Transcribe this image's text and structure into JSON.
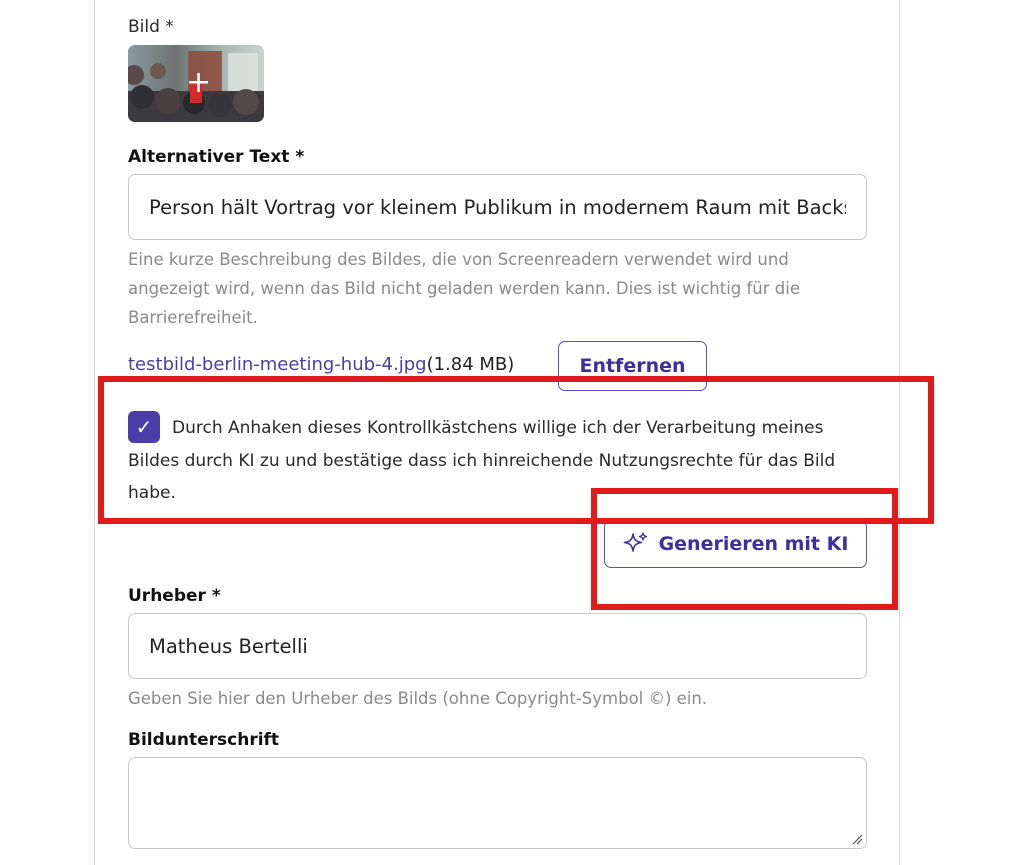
{
  "image_field": {
    "label": "Bild *",
    "add_icon": "plus-icon"
  },
  "alt_text": {
    "label": "Alternativer Text *",
    "value": "Person hält Vortrag vor kleinem Publikum in modernem Raum mit Backst",
    "help": "Eine kurze Beschreibung des Bildes, die von Screenreadern verwendet wird und angezeigt wird, wenn das Bild nicht geladen werden kann. Dies ist wichtig für die Barrierefreiheit."
  },
  "file": {
    "name": "testbild-berlin-meeting-hub-4.jpg",
    "size": "(1.84 MB)",
    "remove_label": "Entfernen"
  },
  "consent": {
    "checked": true,
    "text": "Durch Anhaken dieses Kontrollkästchens willige ich der Verarbeitung meines Bildes durch KI zu und bestätige dass ich hinreichende Nutzungsrechte für das Bild habe."
  },
  "generate": {
    "label": "Generieren mit KI",
    "icon": "sparkle-icon"
  },
  "author": {
    "label": "Urheber *",
    "value": "Matheus Bertelli",
    "help": "Geben Sie hier den Urheber des Bilds (ohne Copyright-Symbol ©) ein."
  },
  "caption": {
    "label": "Bildunterschrift",
    "value": ""
  },
  "colors": {
    "accent": "#4a3da8",
    "highlight": "#e11b1b",
    "help_text": "#8a8a8a"
  }
}
